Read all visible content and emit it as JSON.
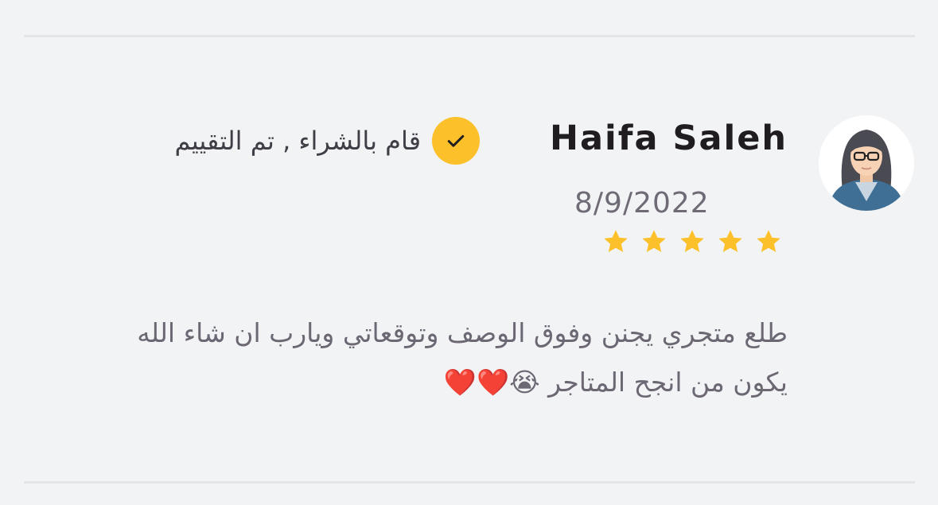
{
  "review": {
    "reviewer_name": "Haifa Saleh",
    "date": "8/9/2022",
    "rating": 5,
    "max_rating": 5,
    "verified_label": "قام بالشراء , تم التقييم",
    "text_line1": "طلع متجري يجنن وفوق الوصف وتوقعاتي ويارب ان شاء الله",
    "text_line2": "يكون من انجح المتاجر",
    "text_emojis": "😭❤️❤️"
  },
  "icons": {
    "avatar": "woman-with-glasses-avatar",
    "verified": "checkmark-icon",
    "star": "star-icon"
  },
  "colors": {
    "background": "#f2f3f5",
    "divider": "#e4e5e8",
    "accent": "#fcc12a",
    "name": "#1f1d1f",
    "muted": "#6e6b76"
  }
}
